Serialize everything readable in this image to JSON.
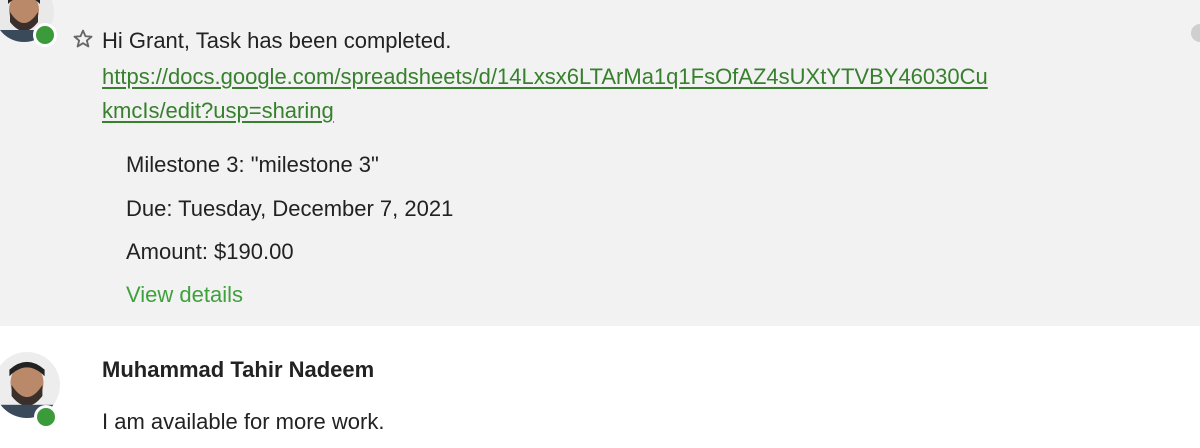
{
  "message1": {
    "greeting": "Hi Grant, Task has been completed.",
    "link_line1": "https://docs.google.com/spreadsheets/d/14Lxsx6LTArMa1q1FsOfAZ4sUXtYTVBY46030Cu",
    "link_line2": "kmcIs/edit?usp=sharing",
    "milestone": "Milestone 3: \"milestone 3\"",
    "due": "Due: Tuesday, December 7, 2021",
    "amount": "Amount: $190.00",
    "view_details": "View details"
  },
  "message2": {
    "sender": "Muhammad Tahir Nadeem",
    "text": "I am available for more work."
  },
  "colors": {
    "link": "#37802d",
    "action": "#3ea13c",
    "status_online": "#3b9b3b",
    "highlight_bg": "#f2f2f2"
  },
  "icons": {
    "star": "star-outline-icon",
    "status": "online-status-icon"
  }
}
